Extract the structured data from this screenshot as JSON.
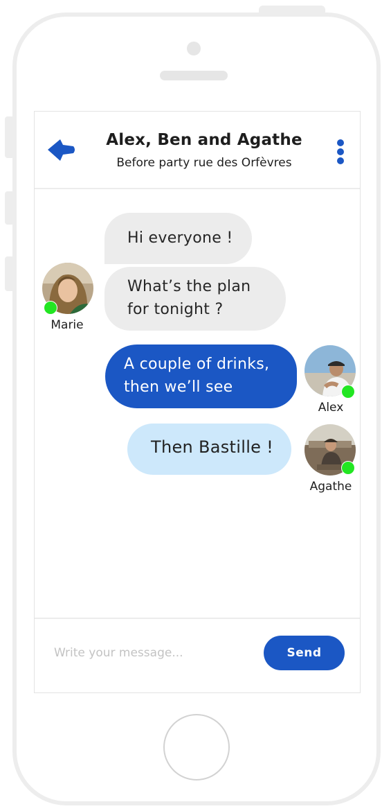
{
  "header": {
    "title": "Alex, Ben and Agathe",
    "subtitle": "Before party rue des Orfèvres",
    "back_icon": "back-arrow-icon",
    "menu_icon": "kebab-menu-icon"
  },
  "messages": [
    {
      "sender": "Marie",
      "text": "Hi everyone !"
    },
    {
      "sender": "Marie",
      "text": "What’s the plan for tonight ?"
    },
    {
      "sender": "Alex",
      "text": "A couple of drinks, then we’ll see"
    },
    {
      "sender": "Agathe",
      "text": "Then Bastille !"
    }
  ],
  "users": {
    "marie": {
      "name": "Marie",
      "online": true
    },
    "alex": {
      "name": "Alex",
      "online": true
    },
    "agathe": {
      "name": "Agathe",
      "online": true
    }
  },
  "composer": {
    "placeholder": "Write your message...",
    "send_label": "Send"
  },
  "colors": {
    "accent": "#1b57c4",
    "incoming_bubble": "#ececec",
    "light_bubble": "#cde8fb",
    "online": "#22e622"
  }
}
